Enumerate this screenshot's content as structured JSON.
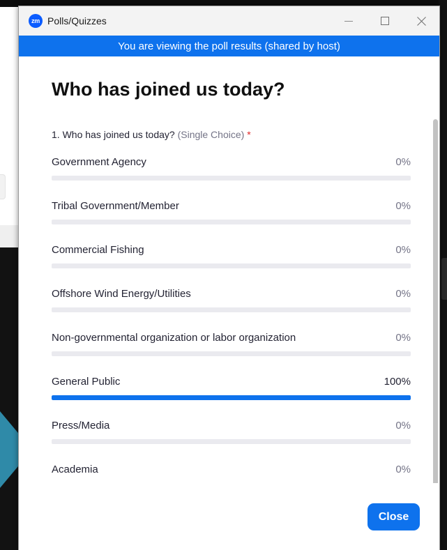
{
  "window": {
    "app_icon_text": "zm",
    "title": "Polls/Quizzes"
  },
  "banner": "You are viewing the poll results (shared by host)",
  "poll": {
    "title": "Who has joined us today?",
    "question": {
      "number": "1.",
      "text": "Who has joined us today?",
      "type": "(Single Choice)",
      "required_marker": "*"
    },
    "options": [
      {
        "label": "Government Agency",
        "percent": "0%",
        "fraction": 0
      },
      {
        "label": "Tribal Government/Member",
        "percent": "0%",
        "fraction": 0
      },
      {
        "label": "Commercial Fishing",
        "percent": "0%",
        "fraction": 0
      },
      {
        "label": "Offshore Wind Energy/Utilities",
        "percent": "0%",
        "fraction": 0
      },
      {
        "label": "Non-governmental organization or labor organization",
        "percent": "0%",
        "fraction": 0
      },
      {
        "label": "General Public",
        "percent": "100%",
        "fraction": 1
      },
      {
        "label": "Press/Media",
        "percent": "0%",
        "fraction": 0
      },
      {
        "label": "Academia",
        "percent": "0%",
        "fraction": 0
      }
    ]
  },
  "footer": {
    "close_label": "Close"
  },
  "colors": {
    "accent": "#0e72ed",
    "track": "#eaeaef",
    "required": "#e02828"
  }
}
